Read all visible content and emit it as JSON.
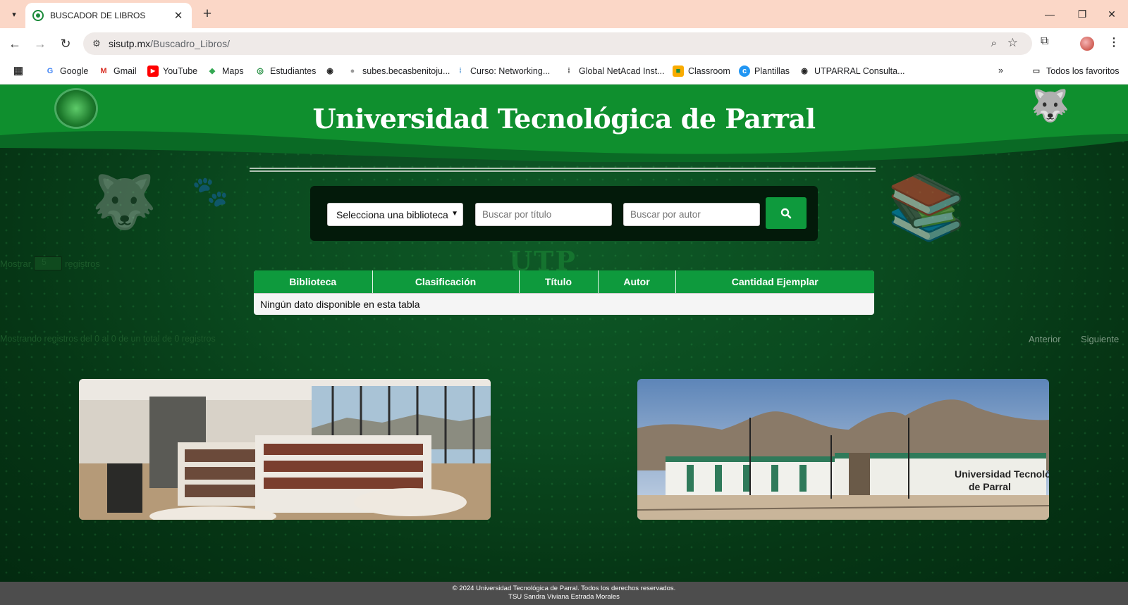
{
  "browser": {
    "tab_title": "BUSCADOR DE LIBROS",
    "tab_close": "✕",
    "new_tab": "+",
    "url_host": "sisutp.mx",
    "url_path": "/Buscadro_Libros/",
    "bookmarks": [
      "Google",
      "Gmail",
      "YouTube",
      "Maps",
      "Estudiantes",
      "subes.becasbenitoju...",
      "Curso: Networking...",
      "Global NetAcad Inst...",
      "Classroom",
      "Plantillas",
      "UTPARRAL Consulta..."
    ],
    "all_bookmarks": "Todos los favoritos"
  },
  "header": {
    "title": "Universidad Tecnológica de Parral"
  },
  "search": {
    "library_select": "Selecciona una biblioteca",
    "title_placeholder": "Buscar por título",
    "author_placeholder": "Buscar por autor"
  },
  "datatable": {
    "length_prefix": "Mostrar",
    "length_value": "5",
    "length_suffix": "registros",
    "columns": [
      "Biblioteca",
      "Clasificación",
      "Título",
      "Autor",
      "Cantidad Ejemplar"
    ],
    "empty_message": "Ningún dato disponible en esta tabla",
    "info": "Mostrando registros del 0 al 0 de un total de 0 registros",
    "prev": "Anterior",
    "next": "Siguiente"
  },
  "footer": {
    "line1": "© 2024 Universidad Tecnológica de Parral. Todos los derechos reservados.",
    "line2": "TSU Sandra Viviana Estrada Morales"
  },
  "campus_sign": "Universidad Tecnológica de Parral",
  "colors": {
    "brand_green": "#0e9a3d",
    "tab_bar": "#fbd7c7",
    "footer": "#4d4d4d"
  }
}
